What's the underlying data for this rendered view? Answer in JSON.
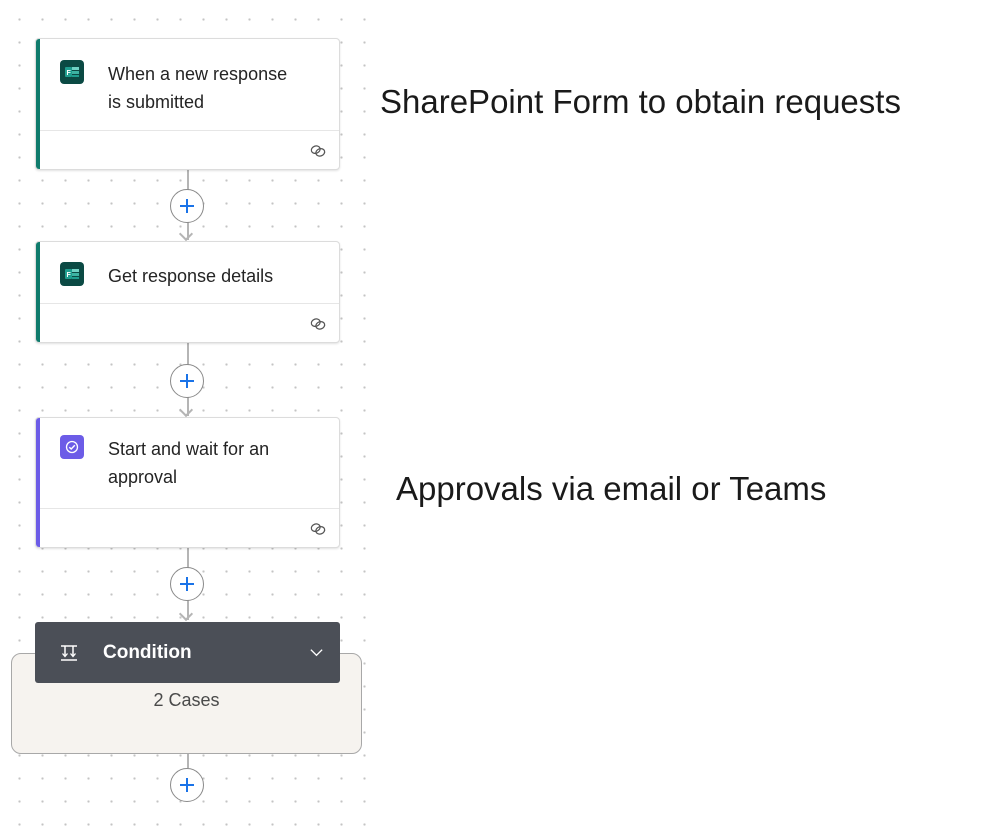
{
  "steps": [
    {
      "title_line1": "When a new response",
      "title_line2": "is submitted",
      "app": "forms-icon",
      "accent": "#0f7b6c"
    },
    {
      "title_line1": "Get response details",
      "app": "forms-icon",
      "accent": "#0f7b6c"
    },
    {
      "title_line1": "Start and wait for an",
      "title_line2": "approval",
      "app": "approval-icon",
      "accent": "#6c5ce7"
    }
  ],
  "condition": {
    "title": "Condition",
    "cases": "2 Cases",
    "icon": "condition-icon",
    "chevron": "chevron-down-icon"
  },
  "annotations": {
    "forms_note": "SharePoint Form to obtain requests",
    "approval_note": "Approvals via email or Teams"
  },
  "colors": {
    "forms_accent": "#0f7b6c",
    "approval_accent": "#6c5ce7",
    "condition_header": "#4b4f57",
    "add_button_plus": "#1a73e8"
  }
}
